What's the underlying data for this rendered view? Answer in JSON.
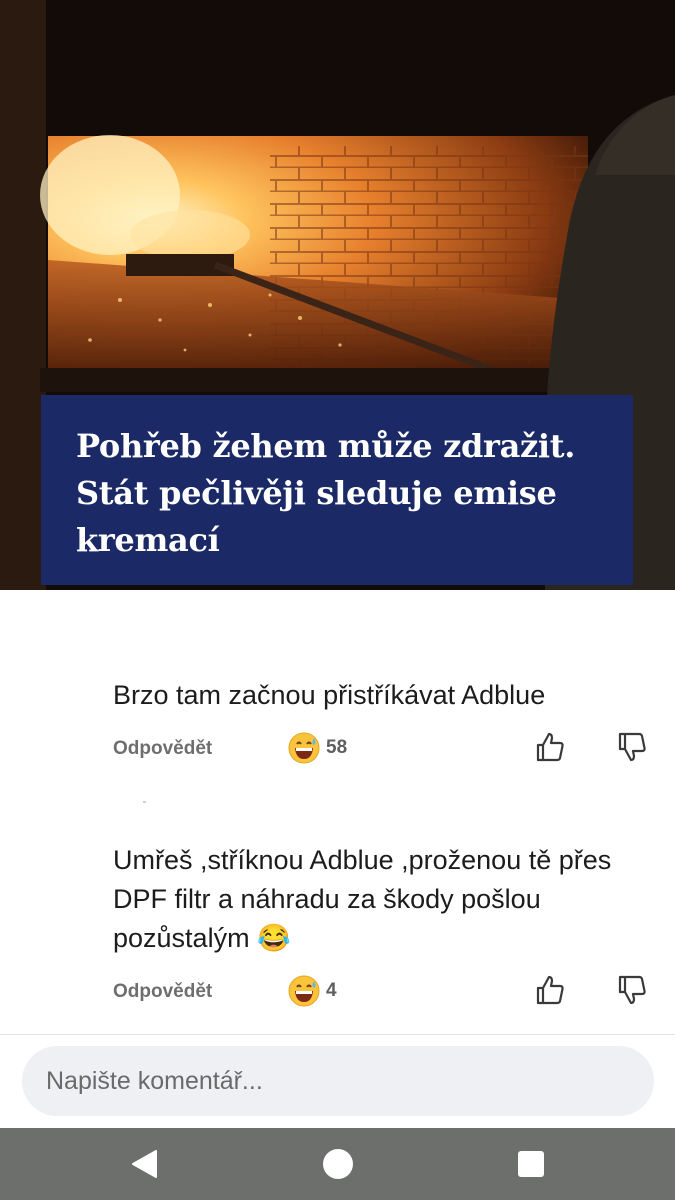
{
  "article": {
    "headline_lines": [
      "Pohřeb žehem může zdražit.",
      "Stát pečlivěji sleduje emise",
      "kremací"
    ]
  },
  "comments": [
    {
      "text": "Brzo tam začnou přistříkávat Adblue",
      "reply_label": "Odpovědět",
      "reaction_count": "58"
    },
    {
      "text": "Umřeš ,stříknou Adblue ,proženou tě přes DPF filtr a náhradu za škody pošlou pozůstalým 😂",
      "reply_label": "Odpovědět",
      "reaction_count": "4"
    }
  ],
  "composer": {
    "placeholder": "Napište komentář..."
  },
  "icons": {
    "reaction": "grinning-sweat-emoji-icon",
    "like": "thumbs-up-icon",
    "dislike": "thumbs-down-icon",
    "nav_back": "back-triangle-icon",
    "nav_home": "home-circle-icon",
    "nav_recents": "recents-square-icon"
  },
  "colors": {
    "headline_bg": "#1b2a66",
    "reply_text": "#6e6e6e",
    "composer_bg": "#eef0f3",
    "navbar_bg": "#6d6f6c"
  }
}
